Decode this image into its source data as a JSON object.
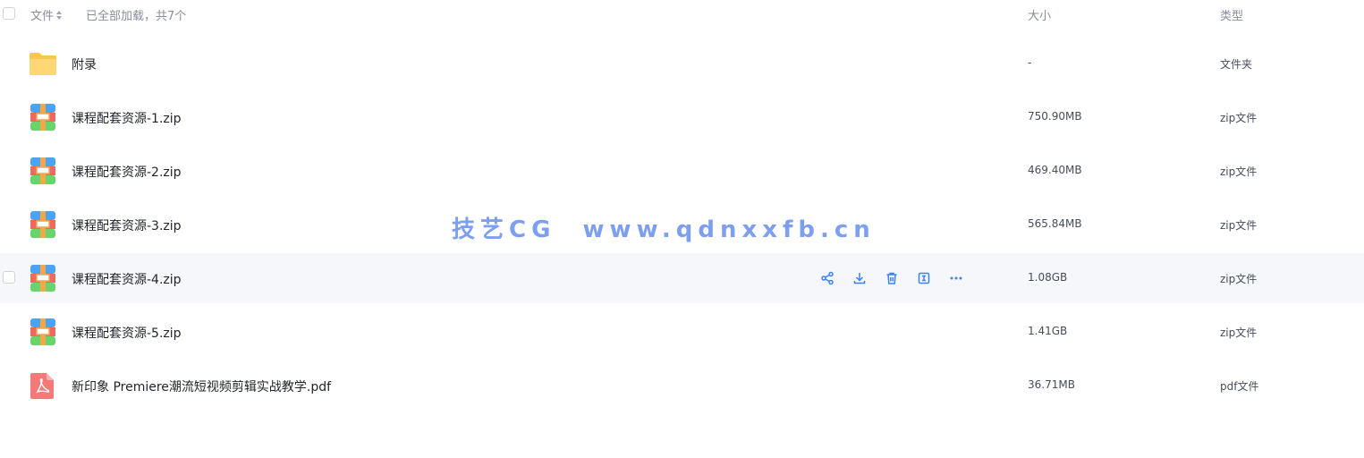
{
  "header": {
    "col_name": "文件",
    "loaded_text": "已全部加载，共7个",
    "col_size": "大小",
    "col_type": "类型"
  },
  "files": [
    {
      "name": "附录",
      "size": "-",
      "type": "文件夹",
      "icon": "folder-icon"
    },
    {
      "name": "课程配套资源-1.zip",
      "size": "750.90MB",
      "type": "zip文件",
      "icon": "zip-icon"
    },
    {
      "name": "课程配套资源-2.zip",
      "size": "469.40MB",
      "type": "zip文件",
      "icon": "zip-icon"
    },
    {
      "name": "课程配套资源-3.zip",
      "size": "565.84MB",
      "type": "zip文件",
      "icon": "zip-icon"
    },
    {
      "name": "课程配套资源-4.zip",
      "size": "1.08GB",
      "type": "zip文件",
      "icon": "zip-icon"
    },
    {
      "name": "课程配套资源-5.zip",
      "size": "1.41GB",
      "type": "zip文件",
      "icon": "zip-icon"
    },
    {
      "name": "新印象 Premiere潮流短视频剪辑实战教学.pdf",
      "size": "36.71MB",
      "type": "pdf文件",
      "icon": "pdf-icon"
    }
  ],
  "row_actions": [
    "share-icon",
    "download-icon",
    "delete-icon",
    "rename-icon",
    "more-icon"
  ],
  "watermark": "技艺CG  www.qdnxxfb.cn",
  "colors": {
    "accent": "#3b82f6",
    "folder": "#ffce5c",
    "pdf": "#f47a7a",
    "hover_row": "#f6f7fb"
  }
}
